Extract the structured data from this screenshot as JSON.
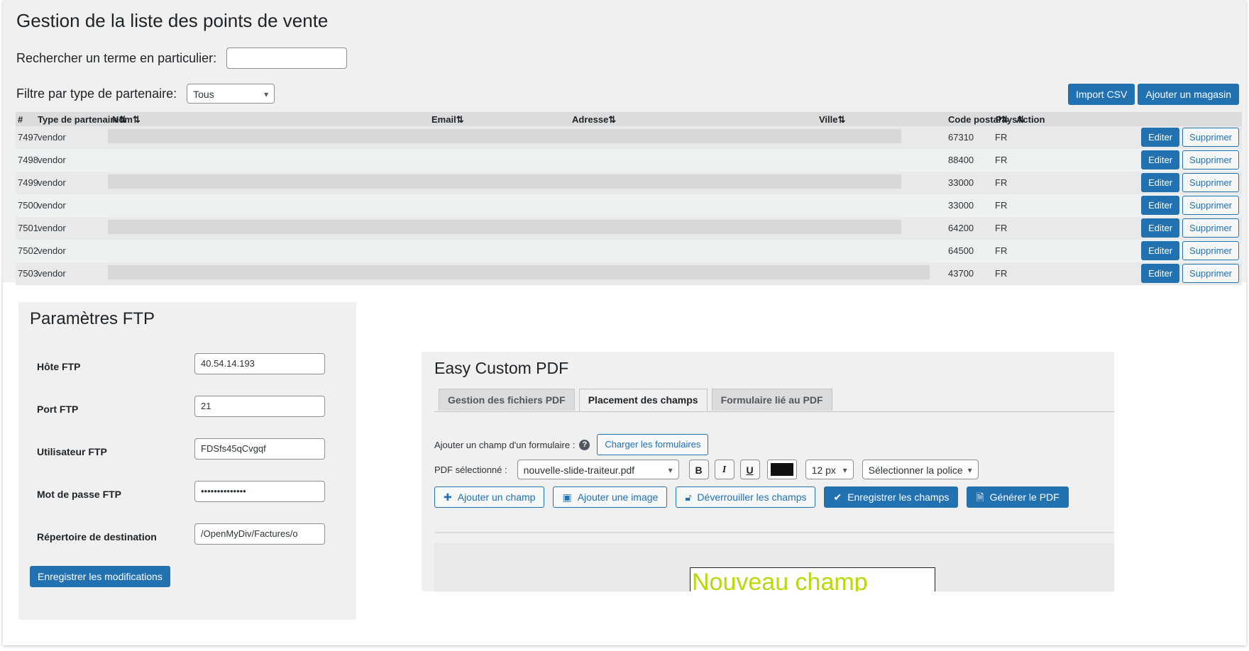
{
  "stores": {
    "title": "Gestion de la liste des points de vente",
    "search_label": "Rechercher un terme en particulier:",
    "search_value": "",
    "filter_label": "Filtre par type de partenaire:",
    "filter_value": "Tous",
    "import_label": "Import CSV",
    "add_label": "Ajouter un magasin",
    "columns": {
      "id": "#",
      "type": "Type de partenaire⇅",
      "name": "Nom⇅",
      "email": "Email⇅",
      "address": "Adresse⇅",
      "city": "Ville⇅",
      "postal": "Code postal⇅",
      "country": "Pays⇅",
      "action": "Action"
    },
    "rows": [
      {
        "id": "7497",
        "type": "vendor",
        "postal": "67310",
        "country": "FR"
      },
      {
        "id": "7498",
        "type": "vendor",
        "postal": "88400",
        "country": "FR"
      },
      {
        "id": "7499",
        "type": "vendor",
        "postal": "33000",
        "country": "FR"
      },
      {
        "id": "7500",
        "type": "vendor",
        "postal": "33000",
        "country": "FR"
      },
      {
        "id": "7501",
        "type": "vendor",
        "postal": "64200",
        "country": "FR"
      },
      {
        "id": "7502",
        "type": "vendor",
        "postal": "64500",
        "country": "FR"
      },
      {
        "id": "7503",
        "type": "vendor",
        "postal": "43700",
        "country": "FR"
      }
    ],
    "edit_label": "Editer",
    "delete_label": "Supprimer"
  },
  "ftp": {
    "title": "Paramètres FTP",
    "host_label": "Hôte FTP",
    "host_value": "40.54.14.193",
    "port_label": "Port FTP",
    "port_value": "21",
    "user_label": "Utilisateur FTP",
    "user_value": "FDSfs45qCvgqf",
    "password_label": "Mot de passe FTP",
    "password_value": "••••••••••••••",
    "dir_label": "Répertoire de destination",
    "dir_value": "/OpenMyDiv/Factures/o",
    "save_label": "Enregistrer les modifications"
  },
  "pdf": {
    "title": "Easy Custom PDF",
    "tabs": [
      "Gestion des fichiers PDF",
      "Placement des champs",
      "Formulaire lié au PDF"
    ],
    "form_field_label": "Ajouter un champ d'un formulaire :",
    "help_glyph": "?",
    "load_forms_label": "Charger les formulaires",
    "selected_label": "PDF sélectionné :",
    "selected_pdf": "nouvelle-slide-traiteur.pdf",
    "bold": "B",
    "italic": "I",
    "underline": "U",
    "text_color": "#111111",
    "font_size": "12 px",
    "font_select": "Sélectionner la police",
    "add_field_label": "Ajouter un champ",
    "add_image_label": "Ajouter une image",
    "unlock_label": "Déverrouiller les champs",
    "save_fields_label": "Enregistrer les champs",
    "generate_label": "Générer le PDF",
    "field_text": "Nouveau champ",
    "field_color": "#b8d80c"
  }
}
